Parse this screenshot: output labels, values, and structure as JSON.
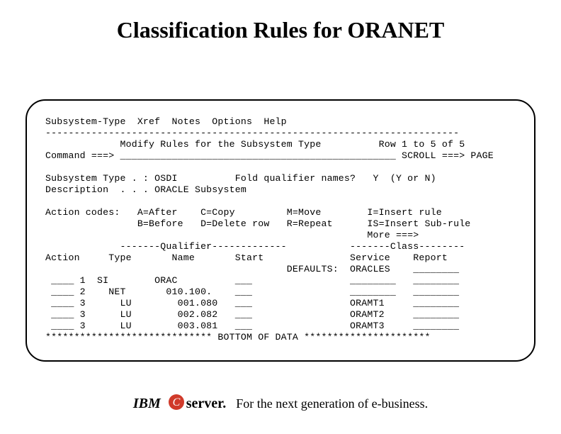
{
  "title": "Classification Rules for ORANET",
  "menu": {
    "items": [
      "Subsystem-Type",
      "Xref",
      "Notes",
      "Options",
      "Help"
    ]
  },
  "divider": "------------------------------------------------------------------------",
  "screen_title": "Modify Rules for the Subsystem Type",
  "row_info": "Row 1 to 5 of 5",
  "command_label": "Command ===>",
  "command_value": "",
  "command_underline": "________________________________________________",
  "scroll_label": "SCROLL ===>",
  "scroll_value": "PAGE",
  "subsystem_type_label": "Subsystem Type . :",
  "subsystem_type_value": "OSDI",
  "fold_label": "Fold qualifier names?",
  "fold_value": "Y",
  "fold_hint": "(Y or N)",
  "description_label": "Description  . . .",
  "description_value": "ORACLE Subsystem",
  "action_codes_label": "Action codes:",
  "action_codes": {
    "A": "After",
    "C": "Copy",
    "M": "Move",
    "I": "Insert rule",
    "B": "Before",
    "D": "Delete row",
    "R": "Repeat",
    "IS": "Insert Sub-rule",
    "More": "More ===>"
  },
  "columns": {
    "qualifier_header": "-------Qualifier-------------",
    "class_header": "-------Class--------",
    "action": "Action",
    "type": "Type",
    "name": "Name",
    "start": "Start",
    "service": "Service",
    "report": "Report",
    "defaults_label": "DEFAULTS:",
    "defaults_service": "ORACLES"
  },
  "rows": [
    {
      "action": "____",
      "n": "1",
      "type": "SI",
      "name": "ORAC",
      "start": "___",
      "service": "________",
      "report": "________"
    },
    {
      "action": "____",
      "n": "2",
      "type": "NET",
      "name": "010.100.",
      "start": "___",
      "service": "________",
      "report": "________"
    },
    {
      "action": "____",
      "n": "3",
      "type": "LU",
      "name": "001.080",
      "start": "___",
      "service": "ORAMT1",
      "report": "________"
    },
    {
      "action": "____",
      "n": "3",
      "type": "LU",
      "name": "002.082",
      "start": "___",
      "service": "ORAMT2",
      "report": "________"
    },
    {
      "action": "____",
      "n": "3",
      "type": "LU",
      "name": "003.081",
      "start": "___",
      "service": "ORAMT3",
      "report": "________"
    }
  ],
  "bottom_marker": "***************************** BOTTOM OF DATA **********************",
  "footer": {
    "ibm": "IBM",
    "server": "server.",
    "e": "e",
    "tagline": "For the next generation of e-business."
  }
}
